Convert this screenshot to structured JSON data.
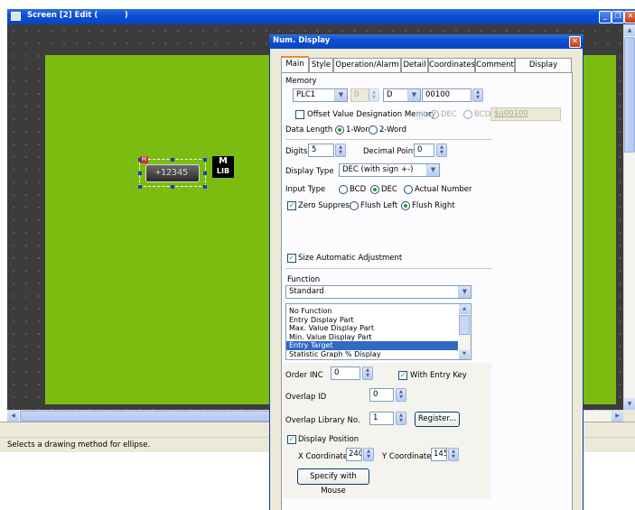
{
  "editor": {
    "title": "Screen [2] Edit (          )",
    "status": "Selects a drawing method for ellipse."
  },
  "canvas": {
    "object_value": "+12345",
    "object_badge": "M",
    "lib_badge_top": "M",
    "lib_badge_bottom": "LIB"
  },
  "dialog": {
    "title": "Num. Display",
    "tabs": [
      "Main",
      "Style",
      "Operation/Alarm",
      "Detail",
      "Coordinates",
      "Comment",
      "Display Setting"
    ],
    "active_tab": "Main",
    "memory": {
      "label": "Memory",
      "plc": "PLC1",
      "station": "0",
      "device": "D",
      "address": "00100",
      "offset_label": "Offset Value Designation Memory",
      "dec_label": "DEC",
      "bcd_label": "BCD",
      "offset_value": "$u00100"
    },
    "data_length": {
      "label": "Data Length",
      "options": [
        "1-Word",
        "2-Word"
      ],
      "selected": "1-Word"
    },
    "digits": {
      "label": "Digits",
      "value": "5"
    },
    "decimal_point": {
      "label": "Decimal Point",
      "value": "0"
    },
    "display_type": {
      "label": "Display Type",
      "value": "DEC (with sign +-)"
    },
    "input_type": {
      "label": "Input Type",
      "options": [
        "BCD",
        "DEC",
        "Actual Number"
      ],
      "selected": "DEC"
    },
    "zero_suppress": {
      "label": "Zero Suppress",
      "checked": true,
      "options": [
        "Flush Left",
        "Flush Right"
      ],
      "selected": "Flush Right"
    },
    "size_auto": {
      "label": "Size Automatic Adjustment",
      "checked": true
    },
    "function": {
      "label": "Function",
      "value": "Standard",
      "list": [
        "No Function",
        "Entry Display Part",
        "Max. Value Display Part",
        "Min. Value Display Part",
        "Entry Target",
        "Statistic Graph % Display"
      ],
      "selected": "Entry Target"
    },
    "order_inc": {
      "label": "Order INC",
      "value": "0"
    },
    "with_entry_key": {
      "label": "With Entry Key",
      "checked": true
    },
    "overlap_id": {
      "label": "Overlap ID",
      "value": "0"
    },
    "overlap_library": {
      "label": "Overlap Library No.",
      "value": "1",
      "button": "Register..."
    },
    "display_position": {
      "label": "Display Position",
      "checked": true,
      "x_label": "X Coordinate",
      "x_value": "240",
      "y_label": "Y Coordinate",
      "y_value": "145",
      "button": "Specify with Mouse"
    }
  },
  "colors": {
    "canvas_green": "#7cbc10",
    "xp_blue": "#0a4fd4",
    "dialog_bg": "#ece9d8",
    "selection": "#316ac5"
  }
}
